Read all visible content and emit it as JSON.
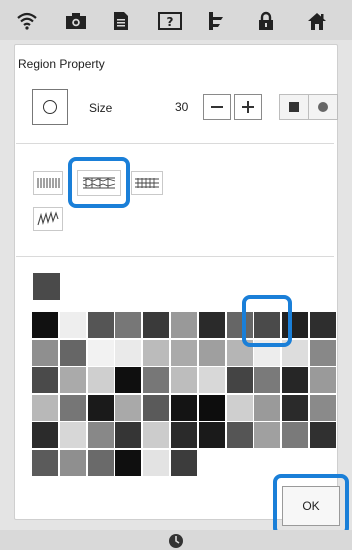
{
  "top_bar": {
    "icons": [
      "wifi-icon",
      "camera-icon",
      "document-icon",
      "help-icon",
      "thread-icon",
      "lock-icon",
      "home-icon"
    ]
  },
  "panel": {
    "title": "Region Property",
    "size_label": "Size",
    "size_value": "30",
    "minus_label": "—",
    "plus_label": "+",
    "selected_color": "#4a4a4a",
    "palette": [
      "#111111",
      "#eeeeee",
      "#555555",
      "#777777",
      "#3a3a3a",
      "#999999",
      "#2a2a2a",
      "#666666",
      "#4a4a4a",
      "#222222",
      "#2e2e2e",
      "#8f8f8f",
      "#666666",
      "#f2f2f2",
      "#eaeaea",
      "#bbbbbb",
      "#aaaaaa",
      "#9f9f9f",
      "#b5b5b5",
      "#ededed",
      "#dddddd",
      "#888888",
      "#4a4a4a",
      "#aaaaaa",
      "#cfcfcf",
      "#0f0f0f",
      "#777777",
      "#bdbdbd",
      "#d8d8d8",
      "#444444",
      "#7a7a7a",
      "#262626",
      "#9a9a9a",
      "#b8b8b8",
      "#767676",
      "#1a1a1a",
      "#a9a9a9",
      "#5a5a5a",
      "#141414",
      "#0d0d0d",
      "#cfcfcf",
      "#9a9a9a",
      "#2a2a2a",
      "#8a8a8a",
      "#2b2b2b",
      "#d7d7d7",
      "#888888",
      "#353535",
      "#cccccc",
      "#2a2a2a",
      "#1a1a1a",
      "#555555",
      "#a0a0a0",
      "#7a7a7a",
      "#303030",
      "#5b5b5b",
      "#8f8f8f",
      "#6a6a6a",
      "#0f0f0f",
      "#e3e3e3",
      "#3c3c3c"
    ],
    "ok_label": "OK"
  },
  "colors": {
    "accent": "#1a7fd8"
  }
}
